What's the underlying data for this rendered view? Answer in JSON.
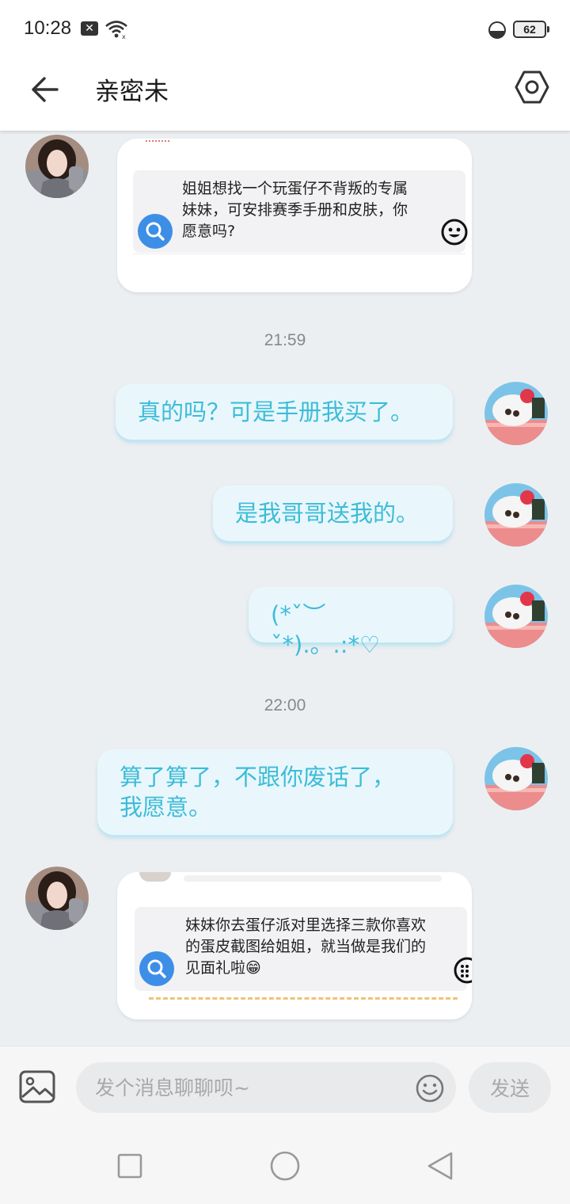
{
  "status_bar": {
    "time": "10:28",
    "notification_badge": "✕",
    "battery": "62"
  },
  "header": {
    "title": "亲密未",
    "back_icon": "arrow-left-icon",
    "settings_icon": "hexagon-settings-icon"
  },
  "messages": [
    {
      "type": "card",
      "side": "left",
      "text": "姐姐想找一个玩蛋仔不背叛的专属妹妹，可安排赛季手册和皮肤，你愿意吗?"
    },
    {
      "type": "timestamp",
      "text": "21:59"
    },
    {
      "type": "bubble",
      "side": "right",
      "text": "真的吗？可是手册我买了。"
    },
    {
      "type": "bubble",
      "side": "right",
      "text": "是我哥哥送我的。"
    },
    {
      "type": "bubble",
      "side": "right",
      "text": "(*ˇ︶ˇ*).。.:*♡"
    },
    {
      "type": "timestamp",
      "text": "22:00"
    },
    {
      "type": "bubble",
      "side": "right",
      "text_line1": "算了算了，不跟你废话了，",
      "text_line2": "我愿意。"
    },
    {
      "type": "card",
      "side": "left",
      "text": "妹妹你去蛋仔派对里选择三款你喜欢的蛋皮截图给姐姐，就当做是我们的见面礼啦😁"
    }
  ],
  "input_bar": {
    "placeholder": "发个消息聊聊呗~",
    "send_label": "发送"
  },
  "colors": {
    "accent": "#3dbcd8",
    "bubble_bg": "#e9f7fc",
    "search_blue": "#3d8ee6"
  }
}
